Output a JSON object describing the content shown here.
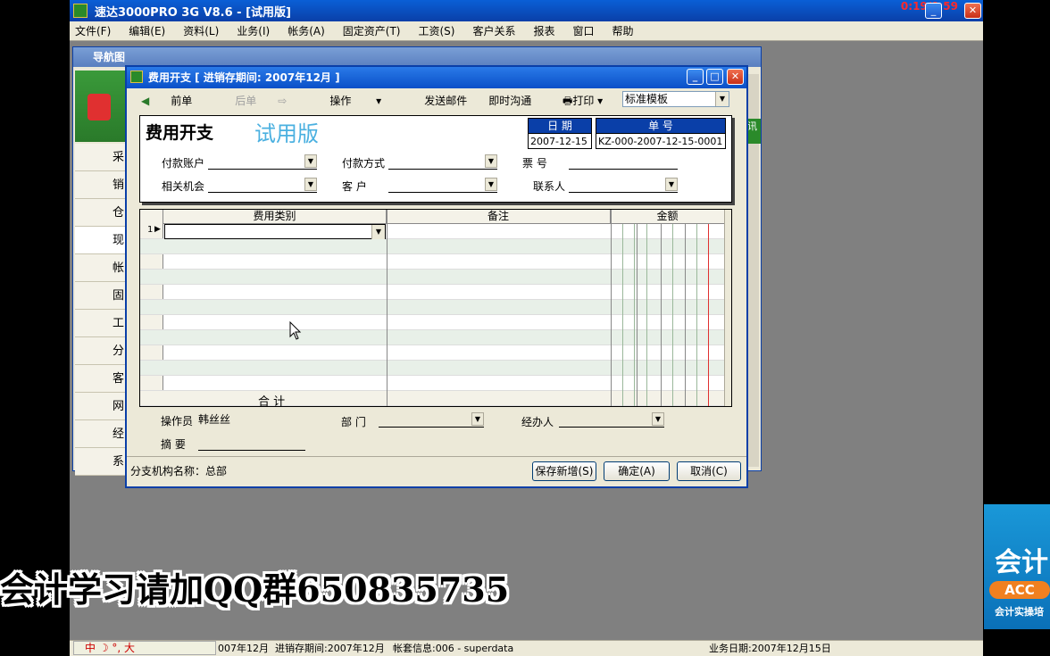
{
  "app": {
    "title": "速达3000PRO 3G V8.6 - [试用版]",
    "timer": "0:19/0:59"
  },
  "menu": [
    "文件(F)",
    "编辑(E)",
    "资料(L)",
    "业务(I)",
    "帐务(A)",
    "固定资产(T)",
    "工资(S)",
    "客户关系",
    "报表",
    "窗口",
    "帮助"
  ],
  "nav": {
    "title": "导航图",
    "items": [
      "采",
      "销",
      "仓",
      "现",
      "帐",
      "固",
      "工",
      "分",
      "客",
      "网",
      "经",
      "系"
    ],
    "right_label": "讯"
  },
  "dialog": {
    "title": "费用开支 [ 进销存期间: 2007年12月 ]",
    "toolbar": {
      "prev": "前单",
      "next": "后单",
      "ops": "操作",
      "mail": "发送邮件",
      "im": "即时沟通",
      "print": "打印",
      "template": "标准模板"
    },
    "form": {
      "title": "费用开支",
      "trial": "试用版",
      "date_label": "日 期",
      "date_value": "2007-12-15",
      "no_label": "单 号",
      "no_value": "KZ-000-2007-12-15-0001",
      "pay_account": "付款账户",
      "pay_method": "付款方式",
      "ticket_no": "票 号",
      "opportunity": "相关机会",
      "customer": "客 户",
      "contact": "联系人"
    },
    "grid": {
      "col_category": "费用类别",
      "col_note": "备注",
      "col_amount": "金额",
      "row1": "1",
      "total": "合 计"
    },
    "footer": {
      "operator_label": "操作员",
      "operator_value": "韩丝丝",
      "dept": "部 门",
      "handler": "经办人",
      "summary": "摘 要",
      "branch": "分支机构名称：总部",
      "save_new": "保存新增(S)",
      "ok": "确定(A)",
      "cancel": "取消(C)"
    }
  },
  "status": {
    "period_cut": "007年12月",
    "inv_period": "进销存期间:2007年12月",
    "account": "帐套信息:006 - superdata",
    "biz_date": "业务日期:2007年12月15日"
  },
  "ime": "中 ☽ °, 大",
  "overlay": "会计学习请加QQ群650835735",
  "ad": {
    "big": "会计",
    "pill": "ACC",
    "small": "会计实操培"
  }
}
